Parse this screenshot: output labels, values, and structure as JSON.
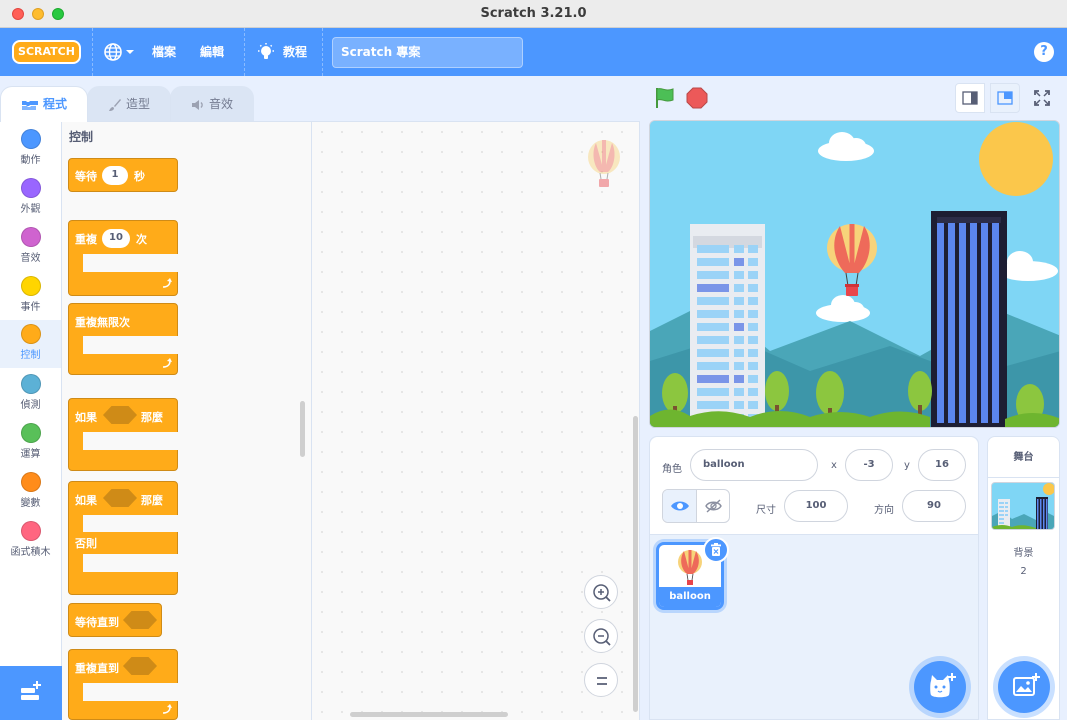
{
  "window": {
    "title": "Scratch 3.21.0"
  },
  "menubar": {
    "logo_text": "SCRATCH",
    "language_icon": "globe-icon",
    "file_label": "檔案",
    "edit_label": "編輯",
    "tutorials_label": "教程",
    "project_title": "Scratch 專案",
    "help_label": "?"
  },
  "tabs": [
    {
      "label": "程式",
      "icon": "code-icon",
      "active": true
    },
    {
      "label": "造型",
      "icon": "brush-icon",
      "active": false
    },
    {
      "label": "音效",
      "icon": "speaker-icon",
      "active": false
    }
  ],
  "categories": [
    {
      "label": "動作",
      "color": "#4c97ff"
    },
    {
      "label": "外觀",
      "color": "#9966ff"
    },
    {
      "label": "音效",
      "color": "#cf63cf"
    },
    {
      "label": "事件",
      "color": "#ffd500"
    },
    {
      "label": "控制",
      "color": "#ffab19",
      "selected": true
    },
    {
      "label": "偵測",
      "color": "#5cb1d6"
    },
    {
      "label": "運算",
      "color": "#59c059"
    },
    {
      "label": "變數",
      "color": "#ff8c1a"
    },
    {
      "label": "函式積木",
      "color": "#ff6680"
    }
  ],
  "palette": {
    "section_title": "控制",
    "wait": {
      "label_a": "等待",
      "value": "1",
      "label_b": "秒"
    },
    "repeat": {
      "label_a": "重複",
      "value": "10",
      "label_b": "次"
    },
    "forever": {
      "label": "重複無限次"
    },
    "if_then": {
      "label_a": "如果",
      "label_b": "那麼"
    },
    "if_else": {
      "label_a": "如果",
      "label_b": "那麼",
      "label_c": "否則"
    },
    "wait_until": {
      "label": "等待直到"
    },
    "repeat_until": {
      "label": "重複直到"
    }
  },
  "sprite_info": {
    "sprite_label": "角色",
    "sprite_name": "balloon",
    "x_label": "x",
    "x_value": "-3",
    "y_label": "y",
    "y_value": "16",
    "show_label": "show-icon",
    "hide_label": "hide-icon",
    "size_label": "尺寸",
    "size_value": "100",
    "direction_label": "方向",
    "direction_value": "90"
  },
  "sprites": [
    {
      "name": "balloon",
      "selected": true
    }
  ],
  "stage_pane": {
    "title": "舞台",
    "backdrops_label": "背景",
    "backdrops_count": "2"
  },
  "colors": {
    "scratch_blue": "#4c97ff",
    "control_orange": "#ffab19",
    "control_orange_dark": "#cf8b17",
    "green_flag": "#4cbf56",
    "stop_red": "#ec5959"
  }
}
